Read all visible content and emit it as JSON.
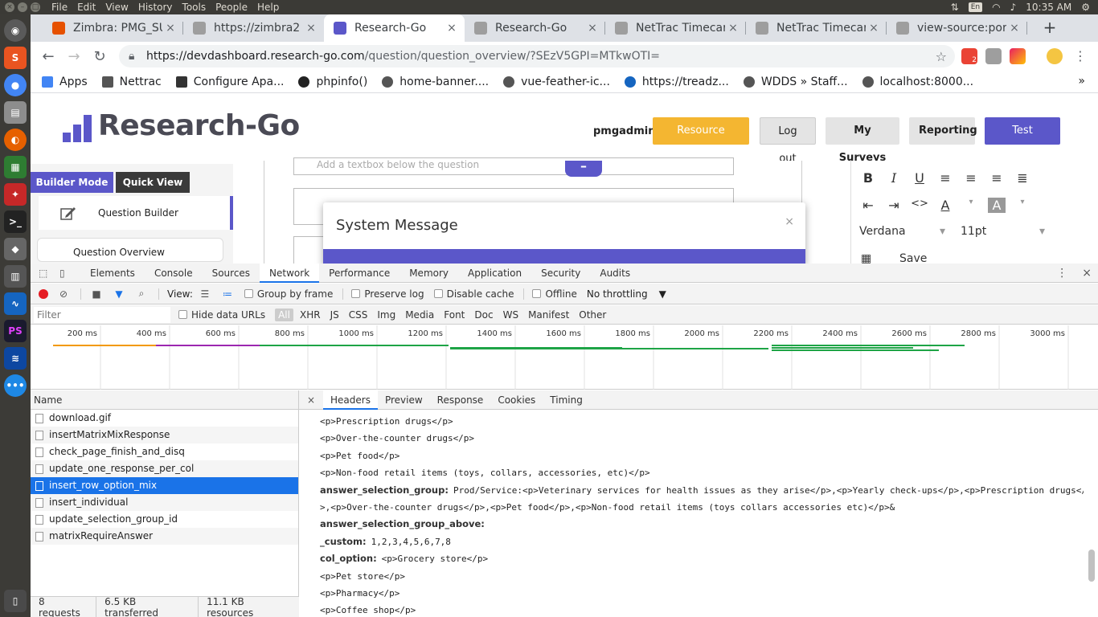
{
  "topbar": {
    "menu": [
      "File",
      "Edit",
      "View",
      "History",
      "Tools",
      "People",
      "Help"
    ],
    "kbd": "En",
    "time": "10:35 AM"
  },
  "browser": {
    "tabs": [
      {
        "title": "Zimbra: PMG_SU",
        "color": "#e65100"
      },
      {
        "title": "https://zimbra2",
        "color": "#9e9e9e"
      },
      {
        "title": "Research-Go",
        "color": "#5b57c9"
      },
      {
        "title": "Research-Go",
        "color": "#9e9e9e"
      },
      {
        "title": "NetTrac Timecar",
        "color": "#9e9e9e"
      },
      {
        "title": "NetTrac Timecar",
        "color": "#9e9e9e"
      },
      {
        "title": "view-source:por",
        "color": "#9e9e9e"
      }
    ],
    "url_host": "https://devdashboard.research-go.com",
    "url_path": "/question/question_overview/?SEzV5GPI=MTkwOTI=",
    "ext_badge": "2",
    "bookmarks": [
      "Apps",
      "Nettrac",
      "Configure Apa...",
      "phpinfo()",
      "home-banner....",
      "vue-feather-ic...",
      "https://treadz...",
      "WDDS » Staff...",
      "localhost:8000..."
    ]
  },
  "site": {
    "logo_text": "Research-Go",
    "user": "pmgadmin",
    "buttons": {
      "resource": "Resource Centre",
      "logout": "Log out",
      "surveys": "My Surveys",
      "reporting": "Reporting",
      "test": "Test Survey"
    },
    "modes": {
      "builder": "Builder Mode",
      "quick": "Quick View"
    },
    "question_builder": "Question Builder",
    "question_overview": "Question Overview",
    "textbox_hint": "Add a textbox below the question",
    "modal_title": "System Message",
    "editor": {
      "font": "Verdana",
      "size": "11pt",
      "save": "Save"
    },
    "colors": {
      "accent": "#5b57c9",
      "resource": "#f4b631",
      "gray_btn": "#e4e4e4"
    }
  },
  "devtools": {
    "tabs": [
      "Elements",
      "Console",
      "Sources",
      "Network",
      "Performance",
      "Memory",
      "Application",
      "Security",
      "Audits"
    ],
    "active_tab": "Network",
    "controls": {
      "view": "View:",
      "group": "Group by frame",
      "preserve": "Preserve log",
      "cache": "Disable cache",
      "offline": "Offline",
      "throttle": "No throttling"
    },
    "filter_placeholder": "Filter",
    "hide_data": "Hide data URLs",
    "types": [
      "All",
      "XHR",
      "JS",
      "CSS",
      "Img",
      "Media",
      "Font",
      "Doc",
      "WS",
      "Manifest",
      "Other"
    ],
    "timeline_ticks": [
      "200 ms",
      "400 ms",
      "600 ms",
      "800 ms",
      "1000 ms",
      "1200 ms",
      "1400 ms",
      "1600 ms",
      "1800 ms",
      "2000 ms",
      "2200 ms",
      "2400 ms",
      "2600 ms",
      "2800 ms",
      "3000 ms"
    ],
    "list_header": "Name",
    "requests": [
      "download.gif",
      "insertMatrixMixResponse",
      "check_page_finish_and_disq",
      "update_one_response_per_col",
      "insert_row_option_mix",
      "insert_individual",
      "update_selection_group_id",
      "matrixRequireAnswer"
    ],
    "selected_request": 4,
    "status": {
      "requests": "8 requests",
      "transferred": "6.5 KB transferred",
      "resources": "11.1 KB resources"
    },
    "detail_tabs": [
      "Headers",
      "Preview",
      "Response",
      "Cookies",
      "Timing"
    ],
    "detail_lines": [
      {
        "key": "",
        "val": "<p>Prescription drugs</p>"
      },
      {
        "key": "",
        "val": "<p>Over-the-counter drugs</p>"
      },
      {
        "key": "",
        "val": "<p>Pet food</p>"
      },
      {
        "key": "",
        "val": "<p>Non-food retail items (toys, collars, accessories, etc)</p>"
      },
      {
        "key": "answer_selection_group:",
        "val": "Prod/Service:<p>Veterinary services  for health issues as they arise</p>,<p>Yearly check-ups</p>,<p>Prescription drugs</p"
      },
      {
        "key": "",
        "val": ">,<p>Over-the-counter drugs</p>,<p>Pet food</p>,<p>Non-food retail items (toys collars accessories etc)</p>&"
      },
      {
        "key": "answer_selection_group_above:",
        "val": ""
      },
      {
        "key": "_custom:",
        "val": "1,2,3,4,5,6,7,8"
      },
      {
        "key": "col_option:",
        "val": "<p>Grocery store</p>"
      },
      {
        "key": "",
        "val": "<p>Pet store</p>"
      },
      {
        "key": "",
        "val": "<p>Pharmacy</p>"
      },
      {
        "key": "",
        "val": "<p>Coffee shop</p>"
      }
    ]
  }
}
